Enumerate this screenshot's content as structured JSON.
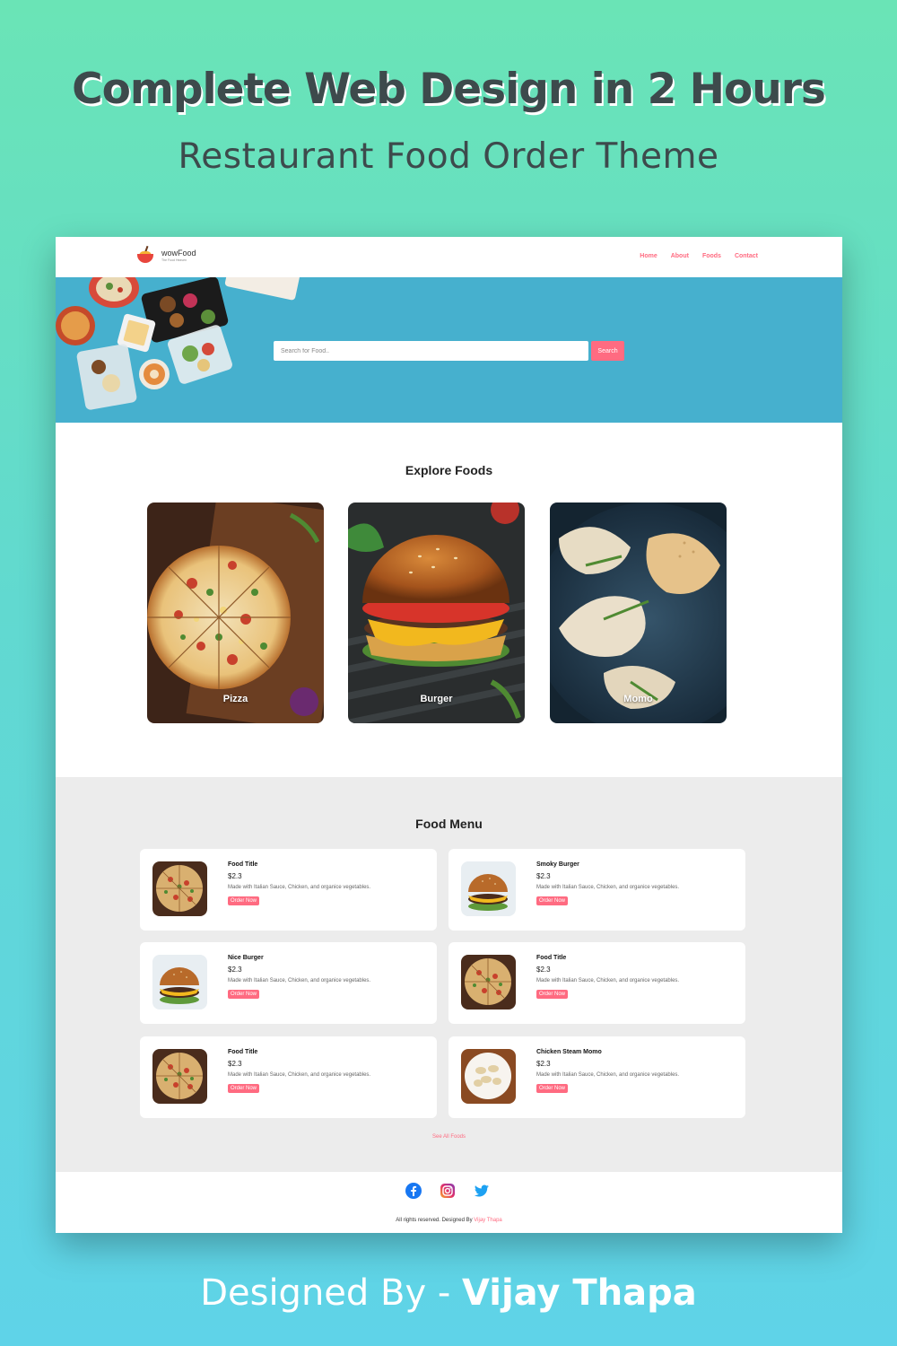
{
  "poster": {
    "title": "Complete Web Design in 2 Hours",
    "subtitle": "Restaurant Food Order Theme",
    "credit_prefix": "Designed By - ",
    "credit_name": "Vijay Thapa"
  },
  "nav": {
    "logo_name": "wowFood",
    "logo_tagline": "The Food Heaven",
    "links": [
      "Home",
      "About",
      "Foods",
      "Contact"
    ]
  },
  "hero": {
    "search_placeholder": "Search for Food..",
    "search_button": "Search"
  },
  "explore": {
    "title": "Explore Foods",
    "categories": [
      "Pizza",
      "Burger",
      "Momo"
    ]
  },
  "menu": {
    "title": "Food Menu",
    "items": [
      {
        "title": "Food Title",
        "price": "$2.3",
        "desc": "Made with Italian Sauce, Chicken, and organice vegetables.",
        "button": "Order Now",
        "image": "pizza"
      },
      {
        "title": "Smoky Burger",
        "price": "$2.3",
        "desc": "Made with Italian Sauce, Chicken, and organice vegetables.",
        "button": "Order Now",
        "image": "burger"
      },
      {
        "title": "Nice Burger",
        "price": "$2.3",
        "desc": "Made with Italian Sauce, Chicken, and organice vegetables.",
        "button": "Order Now",
        "image": "burger"
      },
      {
        "title": "Food Title",
        "price": "$2.3",
        "desc": "Made with Italian Sauce, Chicken, and organice vegetables.",
        "button": "Order Now",
        "image": "pizza"
      },
      {
        "title": "Food Title",
        "price": "$2.3",
        "desc": "Made with Italian Sauce, Chicken, and organice vegetables.",
        "button": "Order Now",
        "image": "pizza"
      },
      {
        "title": "Chicken Steam Momo",
        "price": "$2.3",
        "desc": "Made with Italian Sauce, Chicken, and organice vegetables.",
        "button": "Order Now",
        "image": "momo"
      }
    ],
    "see_all": "See All Foods"
  },
  "footer": {
    "social": [
      "facebook-icon",
      "instagram-icon",
      "twitter-icon"
    ],
    "copyright": "All rights reserved. Designed By ",
    "author": "Vijay Thapa"
  },
  "colors": {
    "accent": "#ff6b81",
    "hero_bg": "#46b0ce",
    "menu_bg": "#ececec"
  }
}
